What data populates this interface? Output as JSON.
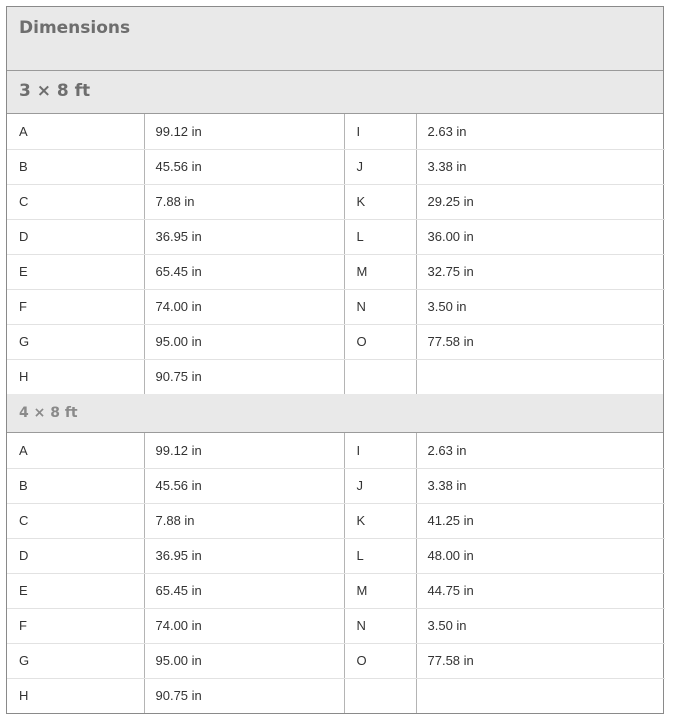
{
  "title": "Dimensions",
  "sections": [
    {
      "heading": "3 × 8 ft",
      "rows": [
        [
          "A",
          "99.12 in",
          "I",
          "2.63 in"
        ],
        [
          "B",
          "45.56 in",
          "J",
          "3.38 in"
        ],
        [
          "C",
          "7.88 in",
          "K",
          "29.25 in"
        ],
        [
          "D",
          "36.95 in",
          "L",
          "36.00 in"
        ],
        [
          "E",
          "65.45 in",
          "M",
          "32.75 in"
        ],
        [
          "F",
          "74.00 in",
          "N",
          "3.50 in"
        ],
        [
          "G",
          "95.00 in",
          "O",
          "77.58 in"
        ],
        [
          "H",
          "90.75 in",
          "",
          ""
        ]
      ]
    },
    {
      "heading": "4 × 8 ft",
      "rows": [
        [
          "A",
          "99.12 in",
          "I",
          "2.63 in"
        ],
        [
          "B",
          "45.56 in",
          "J",
          "3.38 in"
        ],
        [
          "C",
          "7.88 in",
          "K",
          "41.25 in"
        ],
        [
          "D",
          "36.95 in",
          "L",
          "48.00 in"
        ],
        [
          "E",
          "65.45 in",
          "M",
          "44.75 in"
        ],
        [
          "F",
          "74.00 in",
          "N",
          "3.50 in"
        ],
        [
          "G",
          "95.00 in",
          "O",
          "77.58 in"
        ],
        [
          "H",
          "90.75 in",
          "",
          ""
        ]
      ]
    }
  ]
}
